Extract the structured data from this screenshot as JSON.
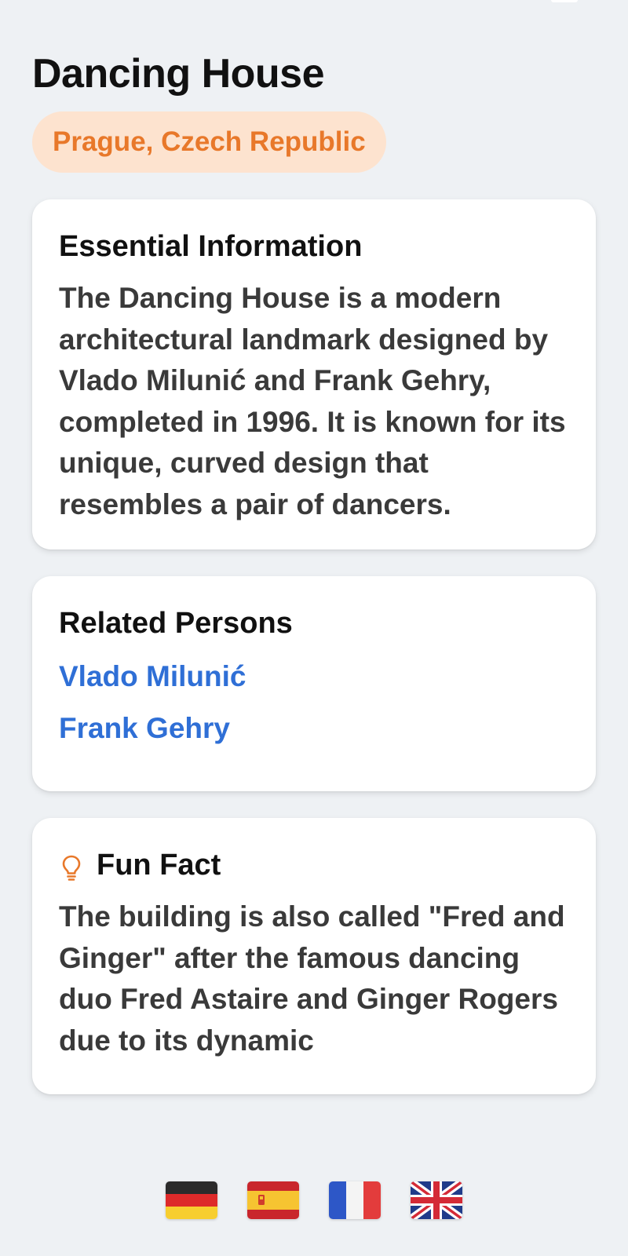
{
  "header": {
    "title": "Dancing House",
    "location": "Prague, Czech Republic"
  },
  "essential": {
    "title": "Essential Information",
    "body": "The Dancing House is a modern architectural landmark designed by Vlado Milunić and Frank Gehry, completed in 1996. It is known for its unique, curved design that resembles a pair of dancers."
  },
  "related": {
    "title": "Related Persons",
    "persons": [
      "Vlado Milunić",
      "Frank Gehry"
    ]
  },
  "fun_fact": {
    "title": "Fun Fact",
    "icon": "lightbulb-icon",
    "body": "The building is also called \"Fred and Ginger\" after the famous dancing duo Fred Astaire and Ginger Rogers due to its dynamic"
  },
  "languages": {
    "flags": [
      "german-flag-icon",
      "spanish-flag-icon",
      "french-flag-icon",
      "uk-flag-icon"
    ]
  },
  "colors": {
    "background": "#eef1f4",
    "accent": "#e8782a",
    "pill_background": "#fde3cf",
    "link": "#2f6fd6"
  }
}
